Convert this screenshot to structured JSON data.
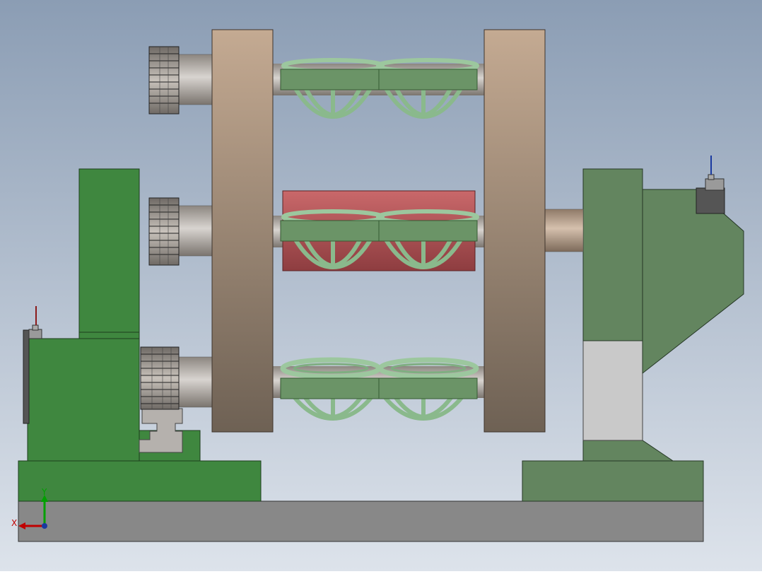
{
  "scene": {
    "type": "CAD model view (front)",
    "colors": {
      "background_top": "#8b9db4",
      "background_bottom": "#dde3eb",
      "base_gray": "#888888",
      "frame_green": "#3f873f",
      "housing_green": "#63855f",
      "spring_green": "#8ab98c",
      "clamp_green": "#6b9467",
      "roller_red": "#c05a5c",
      "disc_tan": "#bfa48c",
      "gear_gray": "#8a8580",
      "light_gray": "#c9c9c9",
      "axis_x": "#c00000",
      "axis_y": "#00a000"
    }
  },
  "triad": {
    "x_label": "X",
    "y_label": "Y"
  }
}
